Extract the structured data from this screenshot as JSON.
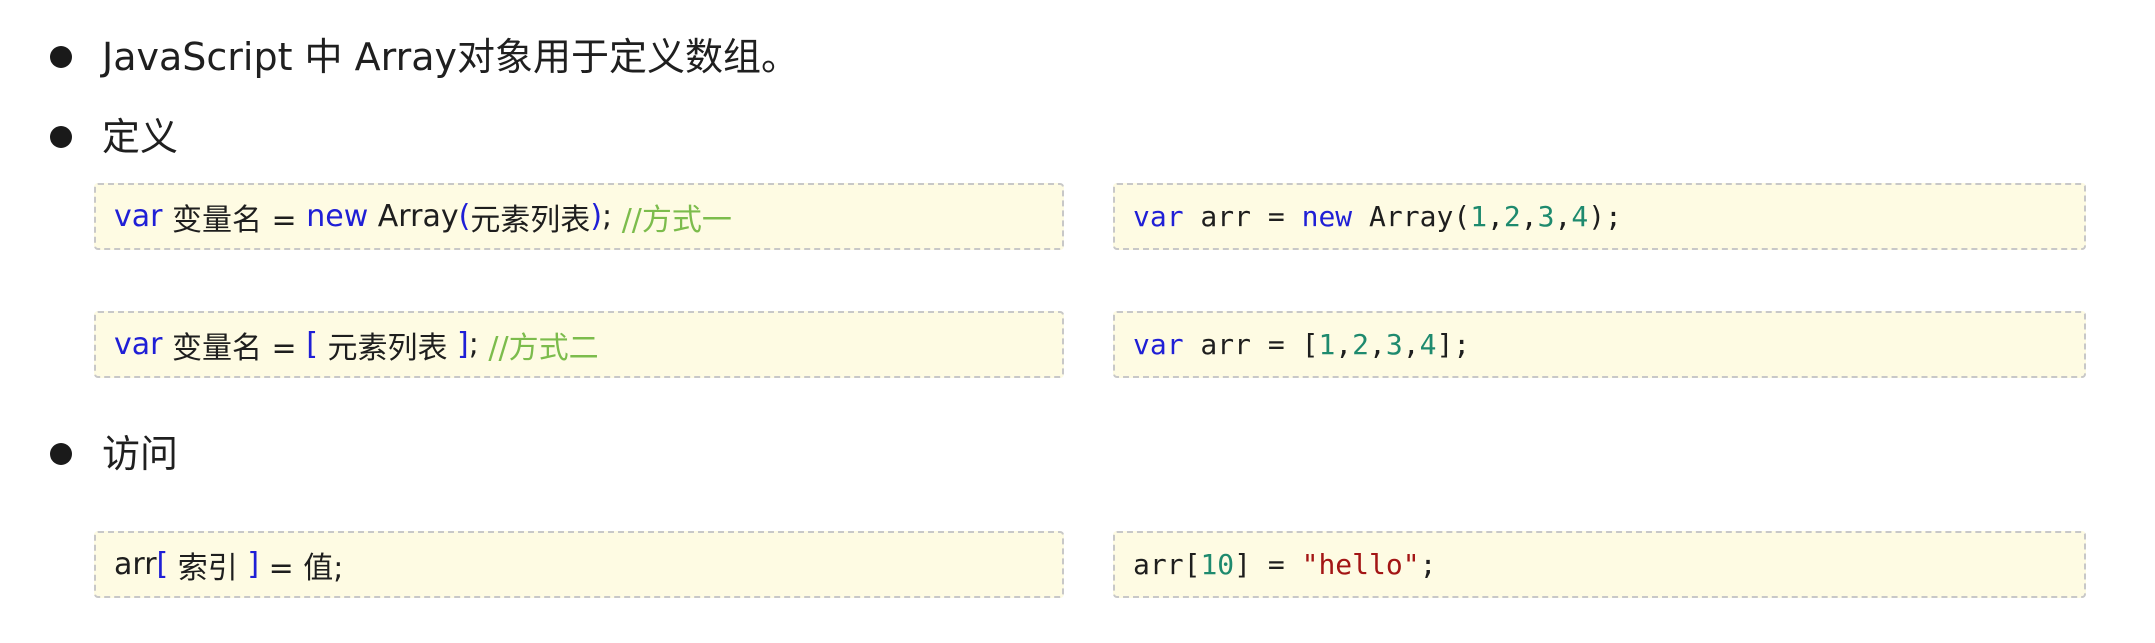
{
  "bullets": {
    "intro": "JavaScript 中 Array对象用于定义数组。",
    "define": "定义",
    "access": "访问"
  },
  "syntax": {
    "method1": {
      "var": "var",
      "name": " 变量名 = ",
      "new": "new",
      "array": " Array",
      "open": "(",
      "elements": "元素列表",
      "close": ")",
      "semi": "; ",
      "comment": "//方式一"
    },
    "method2": {
      "var": "var",
      "name": " 变量名 = ",
      "open": "[",
      "elements": " 元素列表 ",
      "close": "]",
      "semi": "; ",
      "comment": "//方式二"
    },
    "access": {
      "arr": "arr",
      "open": "[",
      "index": " 索引 ",
      "close": "]",
      "assign": " = 值;"
    }
  },
  "examples": {
    "example1": {
      "var": "var",
      "mid": " arr = ",
      "new": "new",
      "array": " Array(",
      "n1": "1",
      "c1": ",",
      "n2": "2",
      "c2": ",",
      "n3": "3",
      "c3": ",",
      "n4": "4",
      "end": ");"
    },
    "example2": {
      "var": "var",
      "mid": " arr = [",
      "n1": "1",
      "c1": ",",
      "n2": "2",
      "c2": ",",
      "n3": "3",
      "c3": ",",
      "n4": "4",
      "end": "];"
    },
    "example3": {
      "arr": "arr[",
      "index": "10",
      "mid": "] = ",
      "str": "\"hello\"",
      "end": ";"
    }
  }
}
